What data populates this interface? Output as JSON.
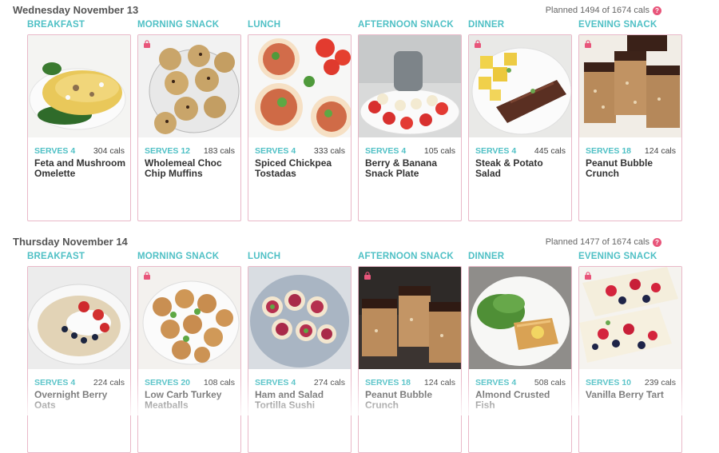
{
  "days": [
    {
      "title": "Wednesday November 13",
      "planned": "Planned 1494 of 1674 cals",
      "meals": [
        {
          "type": "BREAKFAST",
          "serves": "SERVES 4",
          "cals": "304 cals",
          "name": "Feta and Mushroom Omelette",
          "locked": false
        },
        {
          "type": "MORNING SNACK",
          "serves": "SERVES 12",
          "cals": "183 cals",
          "name": "Wholemeal Choc Chip Muffins",
          "locked": true
        },
        {
          "type": "LUNCH",
          "serves": "SERVES 4",
          "cals": "333 cals",
          "name": "Spiced Chickpea Tostadas",
          "locked": false
        },
        {
          "type": "AFTERNOON SNACK",
          "serves": "SERVES 4",
          "cals": "105 cals",
          "name": "Berry & Banana Snack Plate",
          "locked": false
        },
        {
          "type": "DINNER",
          "serves": "SERVES 4",
          "cals": "445 cals",
          "name": "Steak & Potato Salad",
          "locked": true
        },
        {
          "type": "EVENING SNACK",
          "serves": "SERVES 18",
          "cals": "124 cals",
          "name": "Peanut Bubble Crunch",
          "locked": true
        }
      ]
    },
    {
      "title": "Thursday November 14",
      "planned": "Planned 1477 of 1674 cals",
      "meals": [
        {
          "type": "BREAKFAST",
          "serves": "SERVES 4",
          "cals": "224 cals",
          "name": "Overnight Berry Oats",
          "locked": false
        },
        {
          "type": "MORNING SNACK",
          "serves": "SERVES 20",
          "cals": "108 cals",
          "name": "Low Carb Turkey Meatballs",
          "locked": true
        },
        {
          "type": "LUNCH",
          "serves": "SERVES 4",
          "cals": "274 cals",
          "name": "Ham and Salad Tortilla Sushi",
          "locked": false
        },
        {
          "type": "AFTERNOON SNACK",
          "serves": "SERVES 18",
          "cals": "124 cals",
          "name": "Peanut Bubble Crunch",
          "locked": true
        },
        {
          "type": "DINNER",
          "serves": "SERVES 4",
          "cals": "508 cals",
          "name": "Almond Crusted Fish",
          "locked": false
        },
        {
          "type": "EVENING SNACK",
          "serves": "SERVES 10",
          "cals": "239 cals",
          "name": "Vanilla Berry Tart",
          "locked": true
        }
      ]
    }
  ],
  "help_icon": "question-circle-icon",
  "lock_icon": "lock-icon",
  "colors": {
    "accent": "#4fc0c5",
    "card_border": "#e9b8c8",
    "lock": "#e8557a"
  }
}
